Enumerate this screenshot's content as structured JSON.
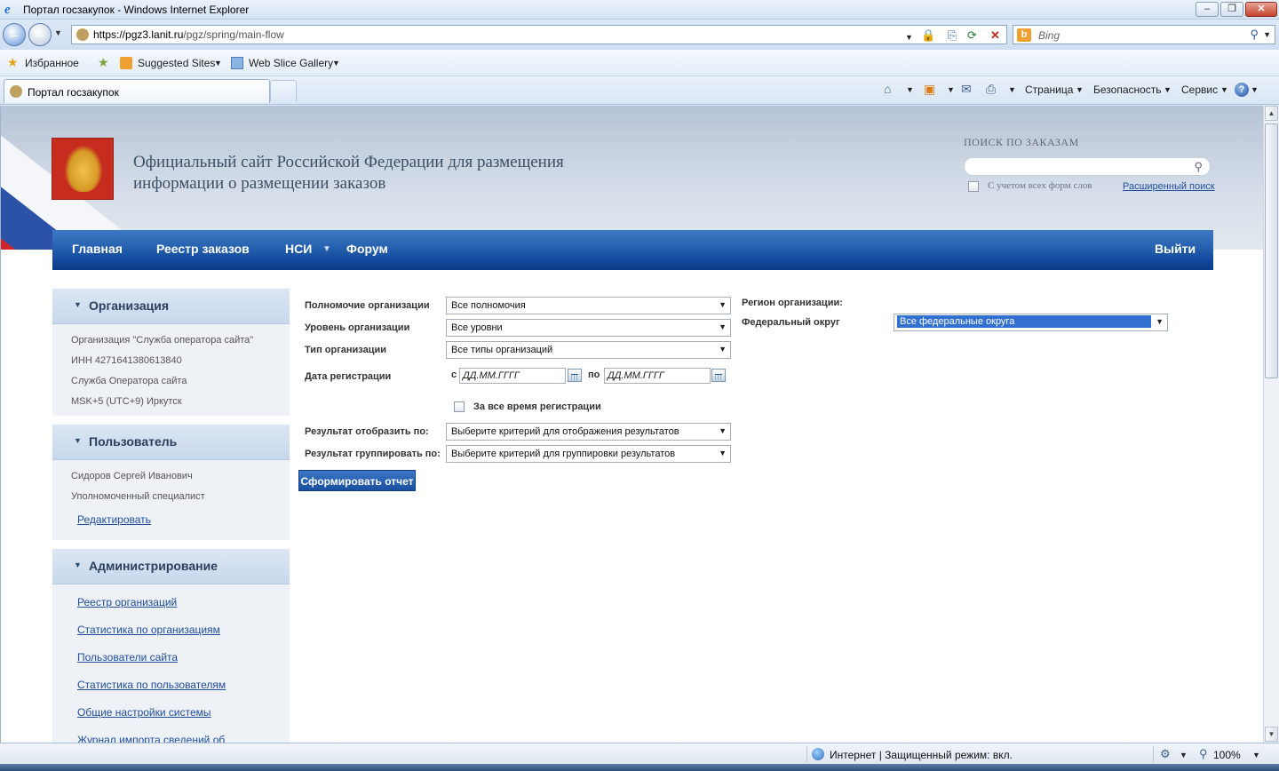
{
  "window": {
    "title": "Портал госзакупок - Windows Internet Explorer"
  },
  "browser": {
    "url_prefix": "https://",
    "url_host": "pgz3.lanit.ru",
    "url_path": "/pgz/spring/main-flow",
    "search_placeholder": "Bing",
    "favorites_label": "Избранное",
    "suggested_sites": "Suggested Sites",
    "web_slice_gallery": "Web Slice Gallery",
    "tab_title": "Портал госзакупок",
    "cmd_page": "Страница",
    "cmd_safety": "Безопасность",
    "cmd_tools": "Сервис"
  },
  "header": {
    "title_line1": "Официальный сайт Российской Федерации для размещения",
    "title_line2": "информации о размещении заказов",
    "search_label": "ПОИСК ПО ЗАКАЗАМ",
    "search_value": "",
    "forms_checkbox_label": "С учетом всех форм слов",
    "advanced_search": "Расширенный поиск"
  },
  "nav": {
    "home": "Главная",
    "orders_registry": "Реестр заказов",
    "nsi": "НСИ",
    "forum": "Форум",
    "logout": "Выйти"
  },
  "sidebar": {
    "organization": {
      "title": "Организация",
      "rows": [
        "Организация \"Служба оператора сайта\"",
        "ИНН 4271641380613840",
        "Служба Оператора сайта",
        "MSK+5 (UTC+9) Иркутск"
      ]
    },
    "user": {
      "title": "Пользователь",
      "name": "Сидоров Сергей Иванович",
      "role": "Уполномоченный специалист",
      "edit_link": "Редактировать"
    },
    "admin": {
      "title": "Администрирование",
      "links": [
        "Реестр организаций",
        "Статистика по организациям",
        "Пользователи сайта",
        "Статистика по пользователям",
        "Общие настройки системы",
        "Журнал импорта сведений об"
      ]
    }
  },
  "form": {
    "authority_label": "Полномочие организации",
    "authority_value": "Все полномочия",
    "level_label": "Уровень организации",
    "level_value": "Все уровни",
    "type_label": "Тип организации",
    "type_value": "Все типы организаций",
    "reg_date_label": "Дата регистрации",
    "from_label": "с",
    "to_label": "по",
    "date_placeholder": "ДД.ММ.ГГГГ",
    "all_time_label": "За все время регистрации",
    "display_by_label": "Результат отобразить по:",
    "display_by_value": "Выберите критерий для отображения результатов",
    "group_by_label": "Результат группировать по:",
    "group_by_value": "Выберите критерий для группировки результатов",
    "submit": "Сформировать отчет",
    "region_label": "Регион организации:",
    "district_label": "Федеральный округ",
    "district_value": "Все федеральные округа"
  },
  "status": {
    "zone": "Интернет | Защищенный режим: вкл.",
    "zoom": "100%"
  }
}
